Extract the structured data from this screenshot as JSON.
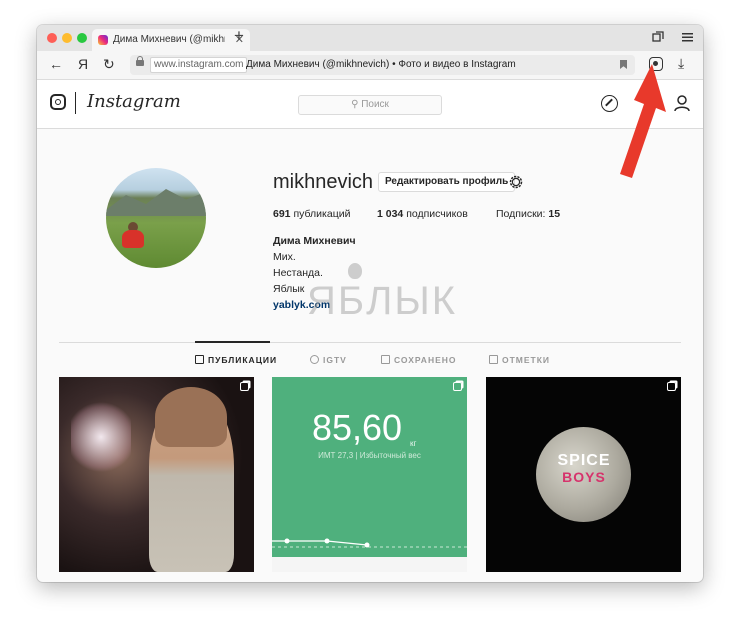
{
  "browser": {
    "tab_title": "Дима Михневич (@mikhnevich)",
    "tab_close": "✕",
    "new_tab": "+",
    "nav": {
      "back": "←",
      "yandex": "Я",
      "reload": "↻"
    },
    "address_domain": "www.instagram.com",
    "page_title": "Дима Михневич (@mikhnevich) • Фото и видео в Instagram",
    "download": "⤓"
  },
  "instagram": {
    "wordmark": "Instagram",
    "search_placeholder": "⚲ Поиск"
  },
  "profile": {
    "username": "mikhnevich",
    "edit_button": "Редактировать профиль",
    "posts_count": "691",
    "posts_label": " публикаций",
    "followers_count": "1 034",
    "followers_label": " подписчиков",
    "following_label": "Подписки: ",
    "following_count": "15",
    "full_name": "Дима Михневич",
    "bio_lines": [
      "Мих.",
      "Нестанда.",
      "Яблык"
    ],
    "website": "yablyk.com"
  },
  "watermark": "ЯБЛЫК",
  "tabs": [
    {
      "label": "ПУБЛИКАЦИИ",
      "active": true
    },
    {
      "label": "IGTV",
      "active": false
    },
    {
      "label": "СОХРАНЕНО",
      "active": false
    },
    {
      "label": "ОТМЕТКИ",
      "active": false
    }
  ],
  "posts": {
    "weight_value": "85,60",
    "weight_unit": "кг",
    "weight_sub": "ИМТ 27,3 | Избыточный вес",
    "moon_text_1": "SPICE",
    "moon_text_2": "BOYS"
  },
  "colors": {
    "arrow": "#e8392b",
    "weight_bg": "#4fb07d",
    "link": "#003569"
  }
}
